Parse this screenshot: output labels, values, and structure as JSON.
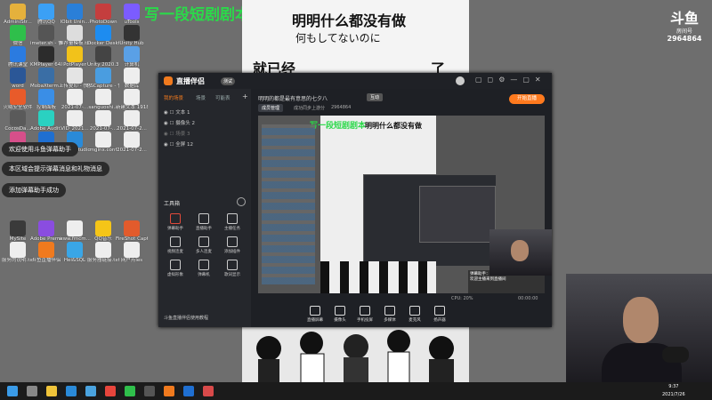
{
  "desktop_icons": [
    {
      "label": "AdminiStr...",
      "color": "#e5b13c"
    },
    {
      "label": "腾讯QQ",
      "color": "#3ba0f5"
    },
    {
      "label": "IObit Unin...",
      "color": "#2a7fd8"
    },
    {
      "label": "PhotoDown",
      "color": "#c43e3e"
    },
    {
      "label": "uTools",
      "color": "#7b5cff"
    },
    {
      "label": "微信",
      "color": "#2fbf4b"
    },
    {
      "label": "imeter.sh - 快捷方式",
      "color": "#555"
    },
    {
      "label": "推荐量模板.txt",
      "color": "#ddd"
    },
    {
      "label": "Docker Desktop",
      "color": "#1d8cf0"
    },
    {
      "label": "Unity Hub",
      "color": "#333"
    },
    {
      "label": "腾讯课堂",
      "color": "#2b7be0"
    },
    {
      "label": "KMPlayer 64X",
      "color": "#2c2c2c"
    },
    {
      "label": "PotPlayer",
      "color": "#f2c21a"
    },
    {
      "label": "Unity 2020.3.12f1",
      "color": "#444"
    },
    {
      "label": "计算机",
      "color": "#5aa0e6"
    },
    {
      "label": "word",
      "color": "#2b5797"
    },
    {
      "label": "MobaXterm - 快捷方式",
      "color": "#3a6ea5"
    },
    {
      "label": "上传复印 - 快捷方式",
      "color": "#e4e4e4"
    },
    {
      "label": "PSCapture - 快捷方式",
      "color": "#4a9de0"
    },
    {
      "label": "数据库",
      "color": "#eee"
    },
    {
      "label": "火绒安全软件",
      "color": "#e85b2a"
    },
    {
      "label": "控制面板",
      "color": "#3a8ee6"
    },
    {
      "label": "2021-07-...",
      "color": "#eee"
    },
    {
      "label": "sanguoshi...",
      "color": "#eee"
    },
    {
      "label": "新建文本 19189072...",
      "color": "#eee"
    },
    {
      "label": "CocosDa...",
      "color": "#5a5a5a"
    },
    {
      "label": "Adobe Audit...",
      "color": "#2ad1c1"
    },
    {
      "label": "VID_2021...",
      "color": "#eee"
    },
    {
      "label": "2021-07-...",
      "color": "#eee"
    },
    {
      "label": "2021-07-2...",
      "color": "#eee"
    },
    {
      "label": "IntelliJ IDEA Community",
      "color": "#d64f8a"
    },
    {
      "label": "Adobe Photosho...",
      "color": "#1f6fd1"
    },
    {
      "label": "Visual Studio Code",
      "color": "#2a8ad8"
    },
    {
      "label": "mginx.conf",
      "color": "#eee"
    },
    {
      "label": "2021-07-2...",
      "color": "#eee"
    },
    {
      "label": "MySite",
      "color": "#3a3a3a"
    },
    {
      "label": "Adobe Premiere...",
      "color": "#8a4de0"
    },
    {
      "label": "www.fmcm...",
      "color": "#eee"
    },
    {
      "label": "QQ音乐",
      "color": "#f5c518"
    },
    {
      "label": "FireShot Capture 0...",
      "color": "#e25b2c"
    },
    {
      "label": "服务的说明.txt",
      "color": "#eee"
    },
    {
      "label": "斗鱼直播伴侣",
      "color": "#f07a1e"
    },
    {
      "label": "Hei&SQL",
      "color": "#3aa6e6"
    },
    {
      "label": "服务器链接.txt",
      "color": "#eee"
    },
    {
      "label": "网户点ies",
      "color": "#eee"
    }
  ],
  "notifications": [
    "欢迎使用斗鱼弹幕助手",
    "本区域会提示弹幕消息和礼物消息",
    "添加弹幕助手成功"
  ],
  "manga": {
    "green_title": "写一段短剧剧本",
    "line1": "明明什么都没有做",
    "line2": "何もしてないのに",
    "line3": "就已经",
    "line4": "了"
  },
  "douyu_logo": {
    "text": "斗鱼",
    "sub": "房间号",
    "room": "2964864"
  },
  "app": {
    "logo_title": "直播伴侣",
    "version_badge": "测试",
    "sidebar_tabs": [
      "我的场景",
      "场景",
      "可能表"
    ],
    "sources": [
      "文本 1",
      "摄像头 2",
      "场景 3",
      "全屏 12"
    ],
    "tools_title": "工具箱",
    "tools": [
      {
        "label": "弹幕助手",
        "color": "#e24a3b"
      },
      {
        "label": "直播助手",
        "color": "#cccccc"
      },
      {
        "label": "主播任务",
        "color": "#cccccc"
      },
      {
        "label": "视频连麦",
        "color": "#cccccc"
      },
      {
        "label": "多人连麦",
        "color": "#cccccc"
      },
      {
        "label": "添加插件",
        "color": "#cccccc"
      },
      {
        "label": "虚拟形象",
        "color": "#cccccc"
      },
      {
        "label": "弹幕机",
        "color": "#cccccc"
      },
      {
        "label": "歌词显示",
        "color": "#cccccc"
      }
    ],
    "help_text": "斗鱼直播伴侣使用教程",
    "stream_title": "明明的都是最有意思的七夕八",
    "stream_tag": "互动",
    "room_button": "成员管理",
    "room_id": "2964864",
    "room_note": "成功同步上游分",
    "start_button": "开始直播",
    "controls": [
      "直播屏幕",
      "摄像头",
      "手机投屏",
      "多媒体",
      "麦克风",
      "扬声器"
    ],
    "status_bar": "CPU: 20%",
    "timer": "00:00:00",
    "chat_overlay": "弹幕助手：测试看下弹幕助手是否开启 欢迎主播来到直播间"
  },
  "taskbar": {
    "apps": [
      {
        "name": "windows-icon",
        "color": "#3a9be8"
      },
      {
        "name": "task-view-icon",
        "color": "#888"
      },
      {
        "name": "explorer-icon",
        "color": "#f0c43a"
      },
      {
        "name": "vscode-icon",
        "color": "#2a8ad8"
      },
      {
        "name": "store-icon",
        "color": "#4aa3df"
      },
      {
        "name": "chrome-icon",
        "color": "#e8453c"
      },
      {
        "name": "wechat-icon",
        "color": "#2fbf4b"
      },
      {
        "name": "terminal-icon",
        "color": "#555"
      },
      {
        "name": "douyu-icon",
        "color": "#f07a1e"
      },
      {
        "name": "photoshop-icon",
        "color": "#1f6fd1"
      },
      {
        "name": "media-icon",
        "color": "#d84a4a"
      }
    ],
    "time": "9:37",
    "date": "2021/7/26"
  }
}
